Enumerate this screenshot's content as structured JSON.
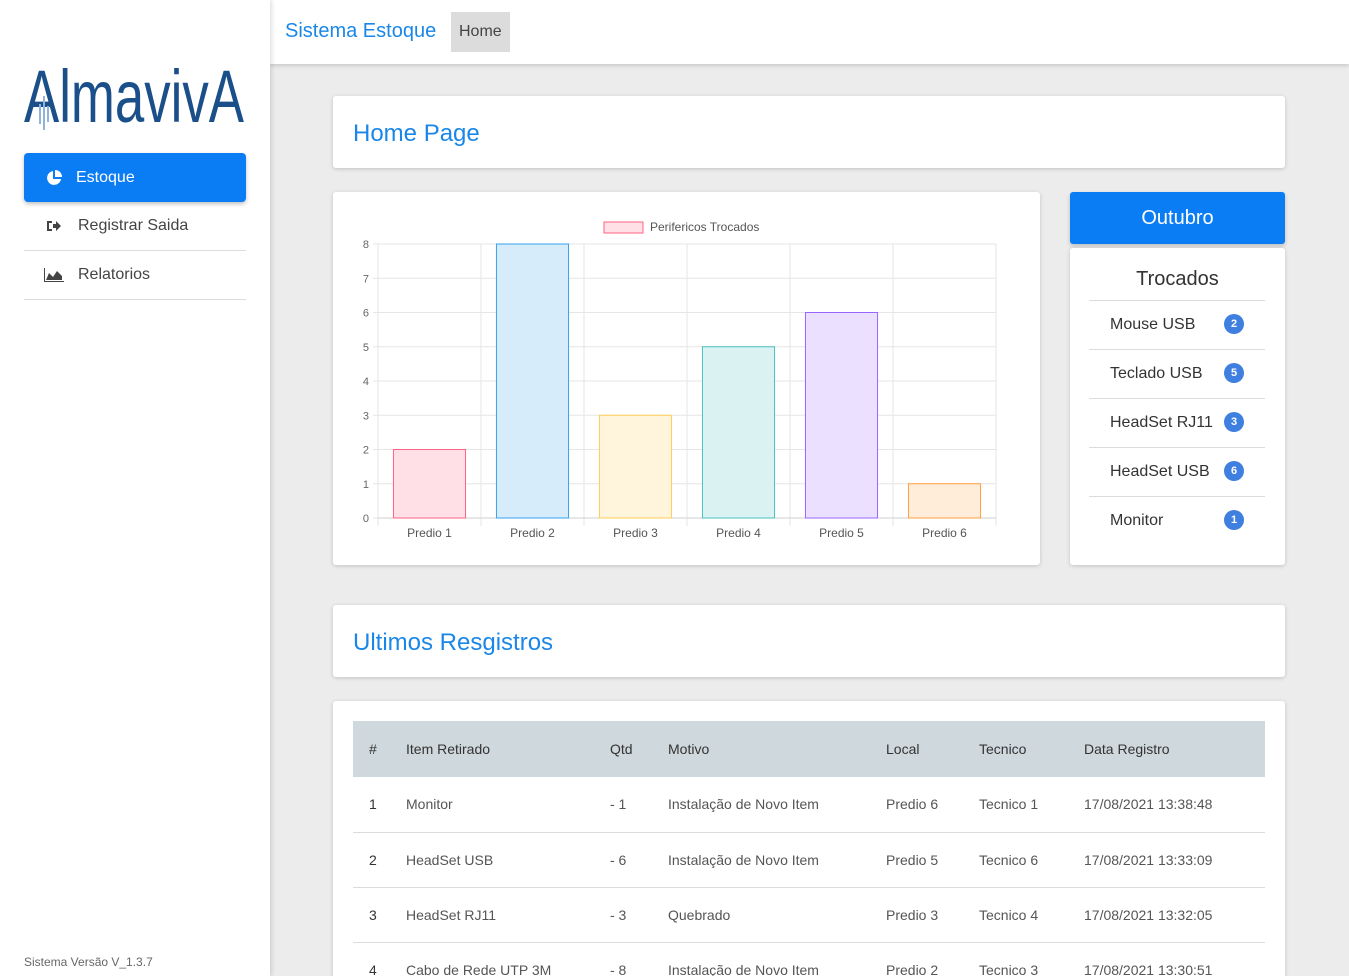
{
  "sidebar": {
    "logo_text": "AlmavivA",
    "items": [
      {
        "label": "Estoque",
        "icon": "pie-chart-icon",
        "active": true
      },
      {
        "label": "Registrar Saida",
        "icon": "sign-out-icon",
        "active": false
      },
      {
        "label": "Relatorios",
        "icon": "area-chart-icon",
        "active": false
      }
    ],
    "version": "Sistema Versão V_1.3.7"
  },
  "header": {
    "brand": "Sistema Estoque",
    "breadcrumb": "Home"
  },
  "home": {
    "title": "Home Page"
  },
  "chart_data": {
    "type": "bar",
    "categories": [
      "Predio 1",
      "Predio 2",
      "Predio 3",
      "Predio 4",
      "Predio 5",
      "Predio 6"
    ],
    "series": [
      {
        "name": "Perifericos Trocados",
        "values": [
          2,
          8,
          3,
          5,
          6,
          1
        ]
      }
    ],
    "ylim": [
      0,
      8
    ],
    "yticks": [
      0,
      1,
      2,
      3,
      4,
      5,
      6,
      7,
      8
    ],
    "grid": true,
    "legend": "top-center",
    "fill_colors": [
      "#ffe0e6",
      "#d7ecfb",
      "#fff5dd",
      "#dbf2f2",
      "#ebe0ff",
      "#ffecd9"
    ],
    "stroke_colors": [
      "#ff6384",
      "#36a2eb",
      "#ffcd56",
      "#4bc0c0",
      "#9966ff",
      "#ff9f40"
    ]
  },
  "month_panel": {
    "month": "Outubro",
    "title": "Trocados",
    "items": [
      {
        "label": "Mouse USB",
        "count": "2"
      },
      {
        "label": "Teclado USB",
        "count": "5"
      },
      {
        "label": "HeadSet RJ11",
        "count": "3"
      },
      {
        "label": "HeadSet USB",
        "count": "6"
      },
      {
        "label": "Monitor",
        "count": "1"
      }
    ]
  },
  "records": {
    "title": "Ultimos Resgistros",
    "columns": [
      "#",
      "Item Retirado",
      "Qtd",
      "Motivo",
      "Local",
      "Tecnico",
      "Data Registro"
    ],
    "rows": [
      [
        "1",
        "Monitor",
        "- 1",
        "Instalação de Novo Item",
        "Predio 6",
        "Tecnico 1",
        "17/08/2021 13:38:48"
      ],
      [
        "2",
        "HeadSet USB",
        "- 6",
        "Instalação de Novo Item",
        "Predio 5",
        "Tecnico 6",
        "17/08/2021 13:33:09"
      ],
      [
        "3",
        "HeadSet RJ11",
        "- 3",
        "Quebrado",
        "Predio 3",
        "Tecnico 4",
        "17/08/2021 13:32:05"
      ],
      [
        "4",
        "Cabo de Rede UTP 3M",
        "- 8",
        "Instalação de Novo Item",
        "Predio 2",
        "Tecnico 3",
        "17/08/2021 13:30:51"
      ]
    ]
  },
  "colors": {
    "primary": "#0a7cf4",
    "title_blue": "#1a87e8",
    "badge": "#3f7fe0",
    "logo_blue": "#1b4f8a"
  }
}
